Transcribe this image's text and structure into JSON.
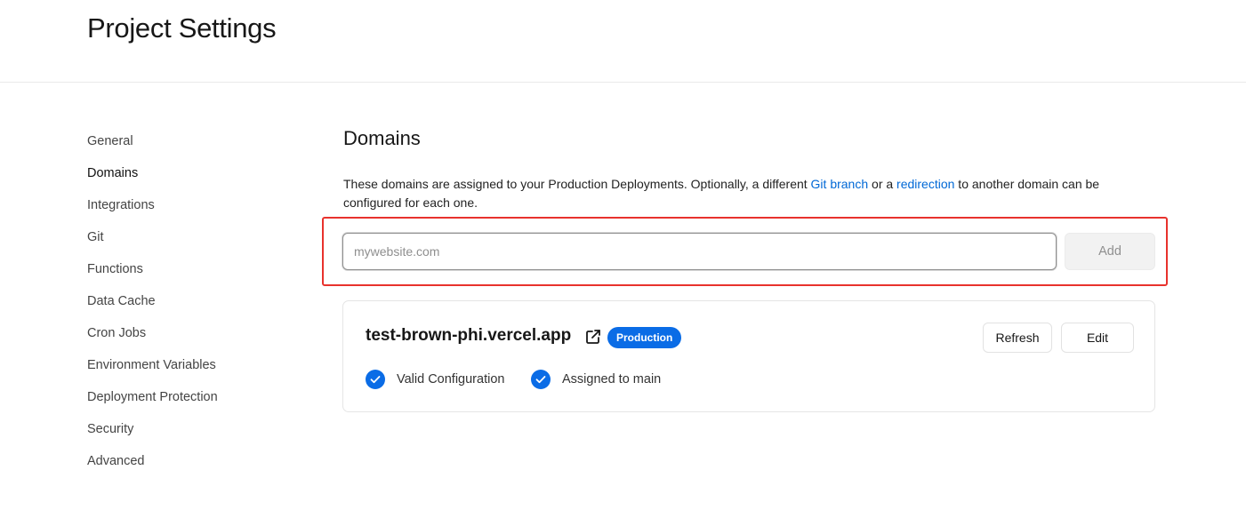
{
  "header": {
    "title": "Project Settings"
  },
  "sidebar": {
    "items": [
      {
        "label": "General"
      },
      {
        "label": "Domains",
        "active": true
      },
      {
        "label": "Integrations"
      },
      {
        "label": "Git"
      },
      {
        "label": "Functions"
      },
      {
        "label": "Data Cache"
      },
      {
        "label": "Cron Jobs"
      },
      {
        "label": "Environment Variables"
      },
      {
        "label": "Deployment Protection"
      },
      {
        "label": "Security"
      },
      {
        "label": "Advanced"
      }
    ]
  },
  "domains": {
    "title": "Domains",
    "description": {
      "part1": "These domains are assigned to your Production Deployments. Optionally, a different ",
      "link1": "Git branch",
      "part2": " or a ",
      "link2": "redirection",
      "part3": " to another domain can be configured for each one."
    },
    "input": {
      "placeholder": "mywebsite.com",
      "value": ""
    },
    "add_label": "Add",
    "card": {
      "domain": "test-brown-phi.vercel.app",
      "external_icon": "external-link-icon",
      "badge": "Production",
      "refresh_label": "Refresh",
      "edit_label": "Edit",
      "statuses": [
        {
          "label": "Valid Configuration",
          "icon": "check-circle-icon"
        },
        {
          "label": "Assigned to main",
          "icon": "check-circle-icon"
        }
      ]
    }
  },
  "colors": {
    "accent": "#0a6ce6",
    "link": "#0068d6",
    "highlight": "#e8322d"
  }
}
